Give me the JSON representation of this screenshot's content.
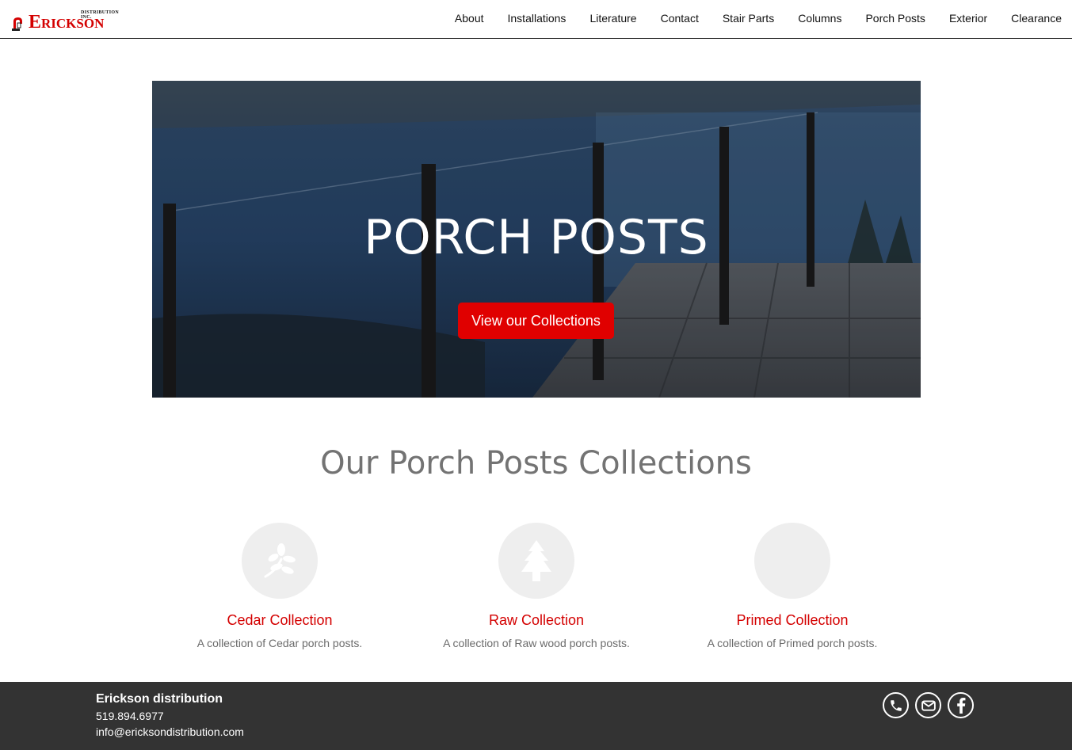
{
  "header": {
    "logo_text": "Erickson",
    "logo_sub": "DISTRIBUTION INC.",
    "nav": [
      {
        "label": "About"
      },
      {
        "label": "Installations"
      },
      {
        "label": "Literature"
      },
      {
        "label": "Contact"
      },
      {
        "label": "Stair Parts"
      },
      {
        "label": "Columns"
      },
      {
        "label": "Porch Posts"
      },
      {
        "label": "Exterior"
      },
      {
        "label": "Clearance"
      }
    ]
  },
  "hero": {
    "title": "PORCH POSTS",
    "button_label": "View our Collections"
  },
  "collections": {
    "title": "Our Porch Posts Collections",
    "items": [
      {
        "icon": "leaf-icon",
        "title": "Cedar Collection",
        "description": "A collection of Cedar porch posts."
      },
      {
        "icon": "tree-icon",
        "title": "Raw Collection",
        "description": "A collection of Raw wood porch posts."
      },
      {
        "icon": "blank-icon",
        "title": "Primed Collection",
        "description": "A collection of Primed porch posts."
      }
    ]
  },
  "footer": {
    "company": "Erickson distribution",
    "phone": "519.894.6977",
    "email": "info@ericksondistribution.com",
    "socials": [
      "phone-icon",
      "email-icon",
      "facebook-icon"
    ]
  },
  "colors": {
    "brand_red": "#e00000",
    "footer_bg": "#333333",
    "heading_gray": "#737373"
  }
}
